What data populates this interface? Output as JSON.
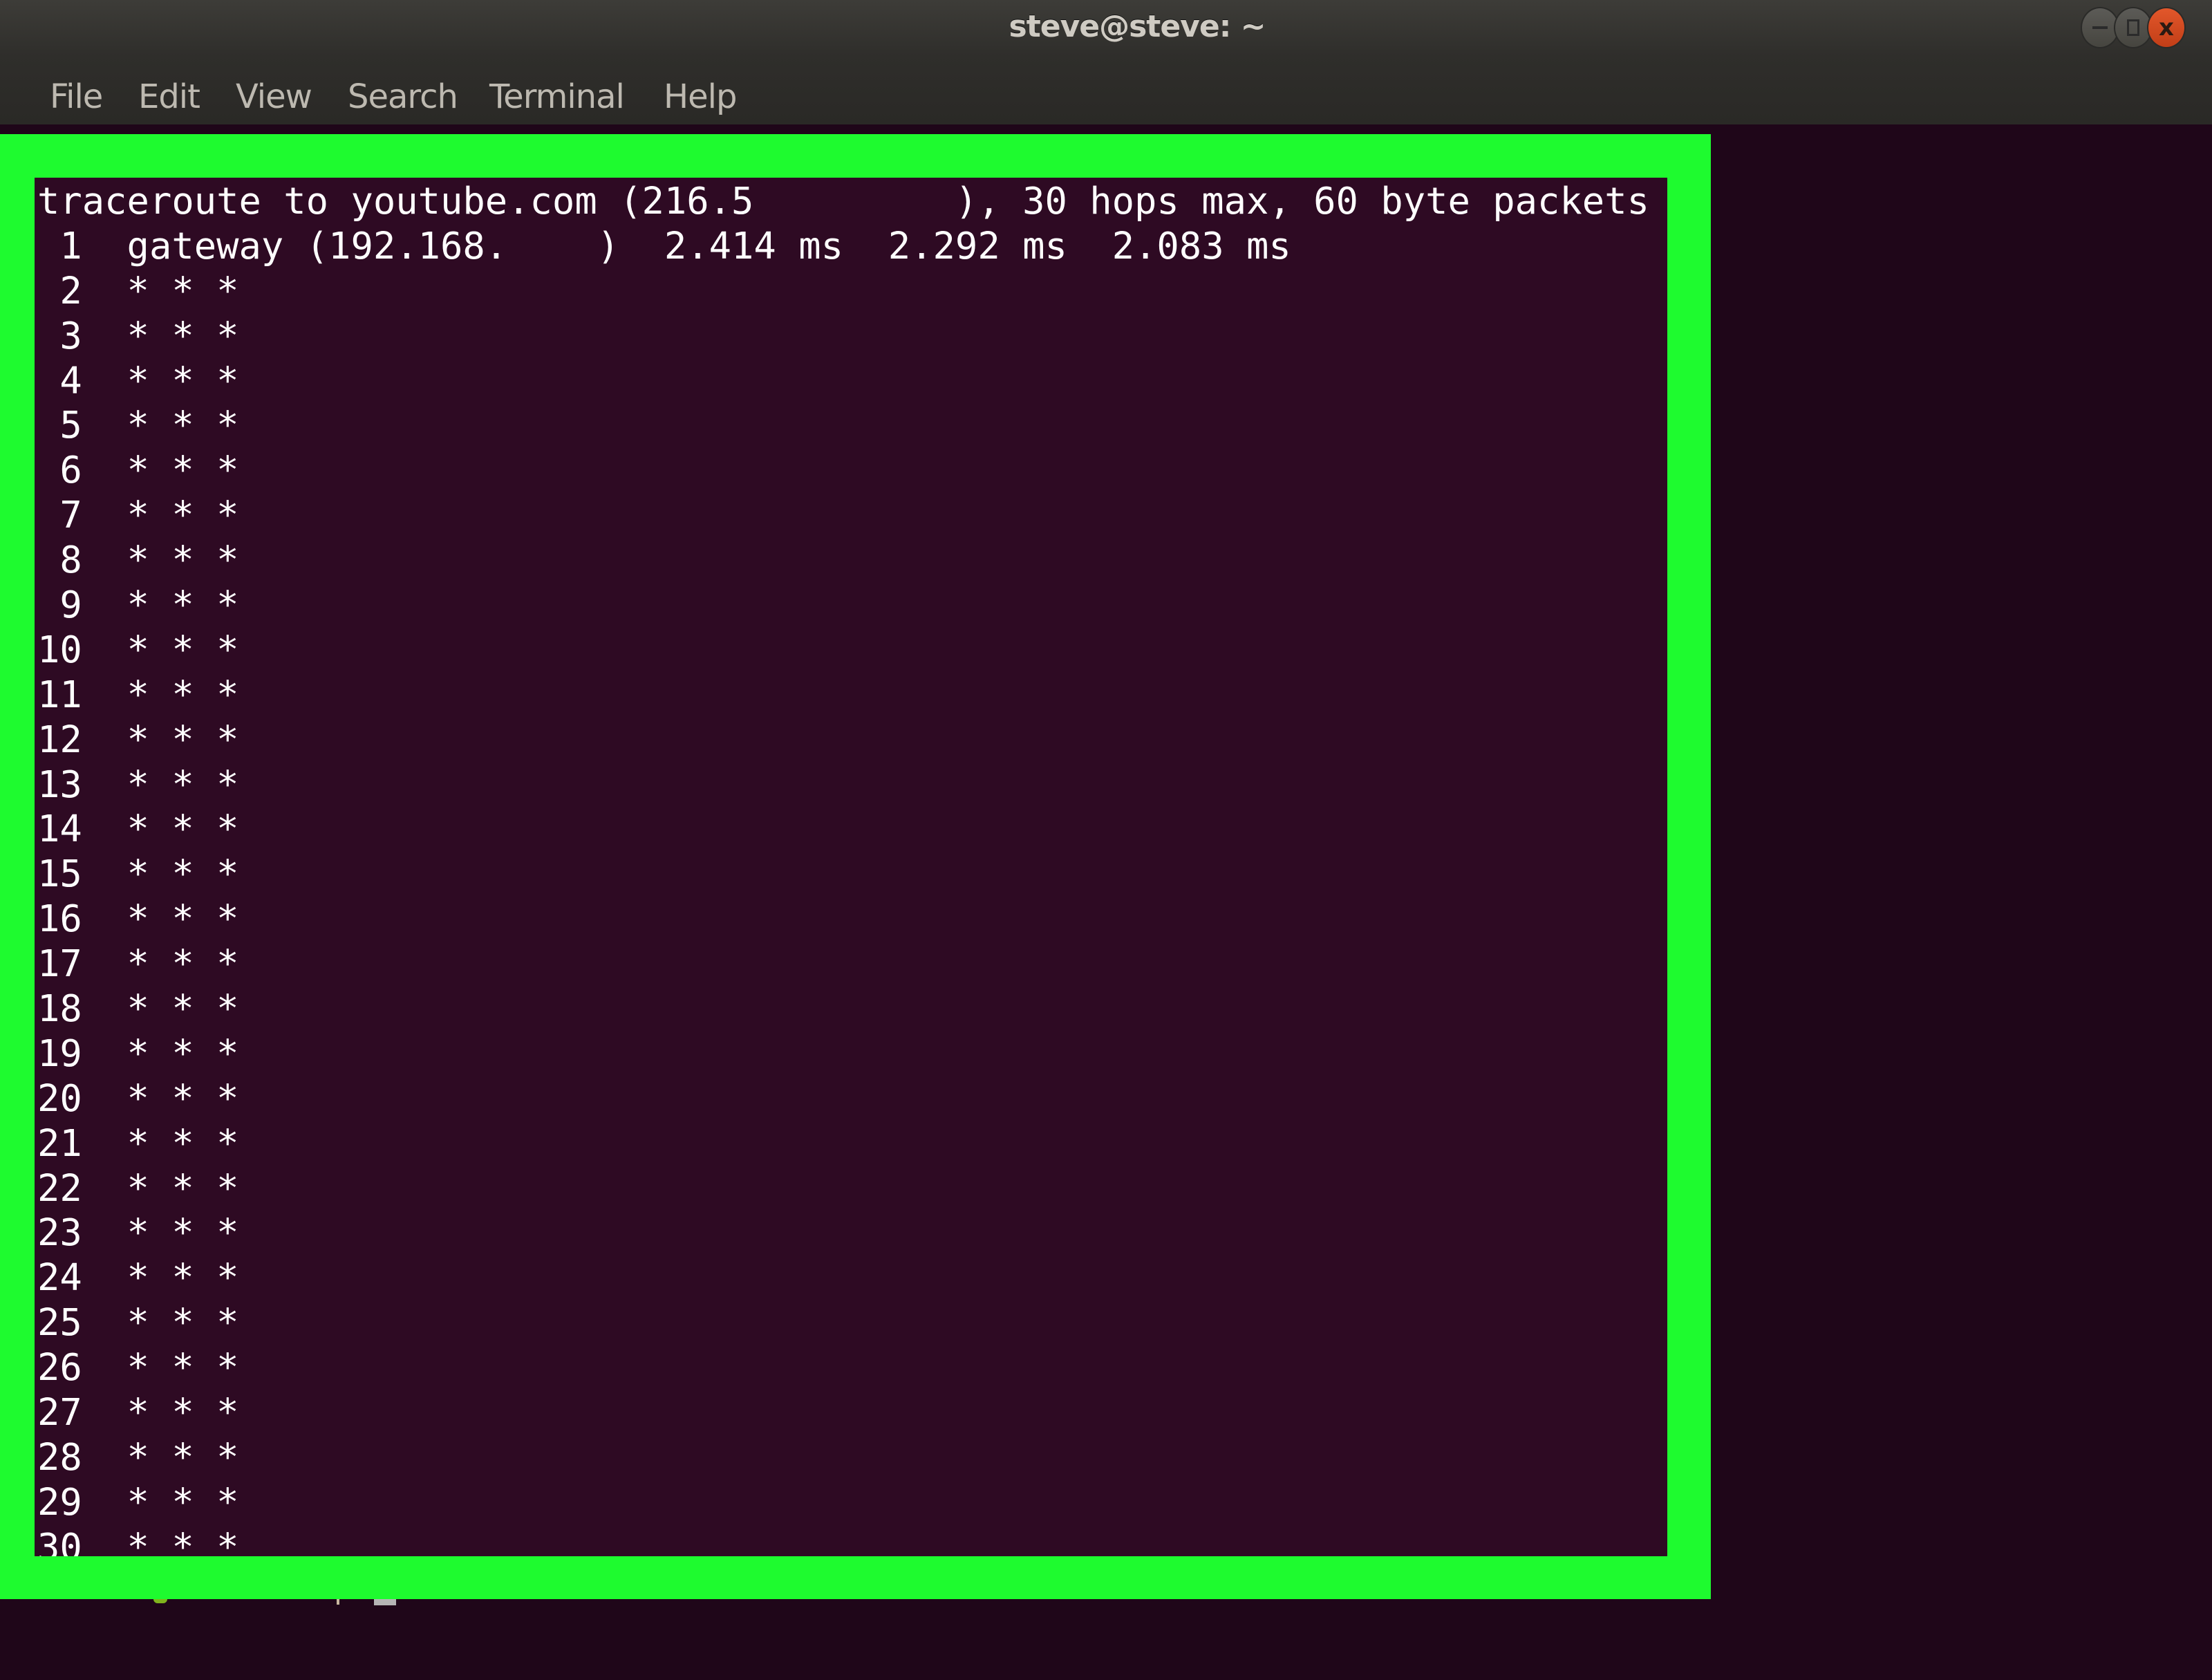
{
  "window": {
    "title": "steve@steve: ~",
    "controls": {
      "minimize_icon": "minimize-icon",
      "maximize_icon": "maximize-icon",
      "close_icon": "close-icon",
      "close_glyph": "x",
      "close_color": "#d84d22"
    }
  },
  "menubar": {
    "items": [
      {
        "label": "File"
      },
      {
        "label": "Edit"
      },
      {
        "label": "View"
      },
      {
        "label": "Search"
      },
      {
        "label": "Terminal"
      },
      {
        "label": "Help"
      }
    ]
  },
  "terminal": {
    "colors": {
      "background": "#2e0a23",
      "foreground": "#ffffff",
      "highlight_frame": "#1efb2f"
    },
    "header": "traceroute to youtube.com (216.5         ), 30 hops max, 60 byte packets",
    "hops": [
      " 1  gateway (192.168.    )  2.414 ms  2.292 ms  2.083 ms",
      " 2  * * *",
      " 3  * * *",
      " 4  * * *",
      " 5  * * *",
      " 6  * * *",
      " 7  * * *",
      " 8  * * *",
      " 9  * * *",
      "10  * * *",
      "11  * * *",
      "12  * * *",
      "13  * * *",
      "14  * * *",
      "15  * * *",
      "16  * * *",
      "17  * * *",
      "18  * * *",
      "19  * * *",
      "20  * * *",
      "21  * * *",
      "22  * * *",
      "23  * * *",
      "24  * * *",
      "25  * * *",
      "26  * * *",
      "27  * * *",
      "28  * * *",
      "29  * * *",
      "30  * * *"
    ]
  }
}
